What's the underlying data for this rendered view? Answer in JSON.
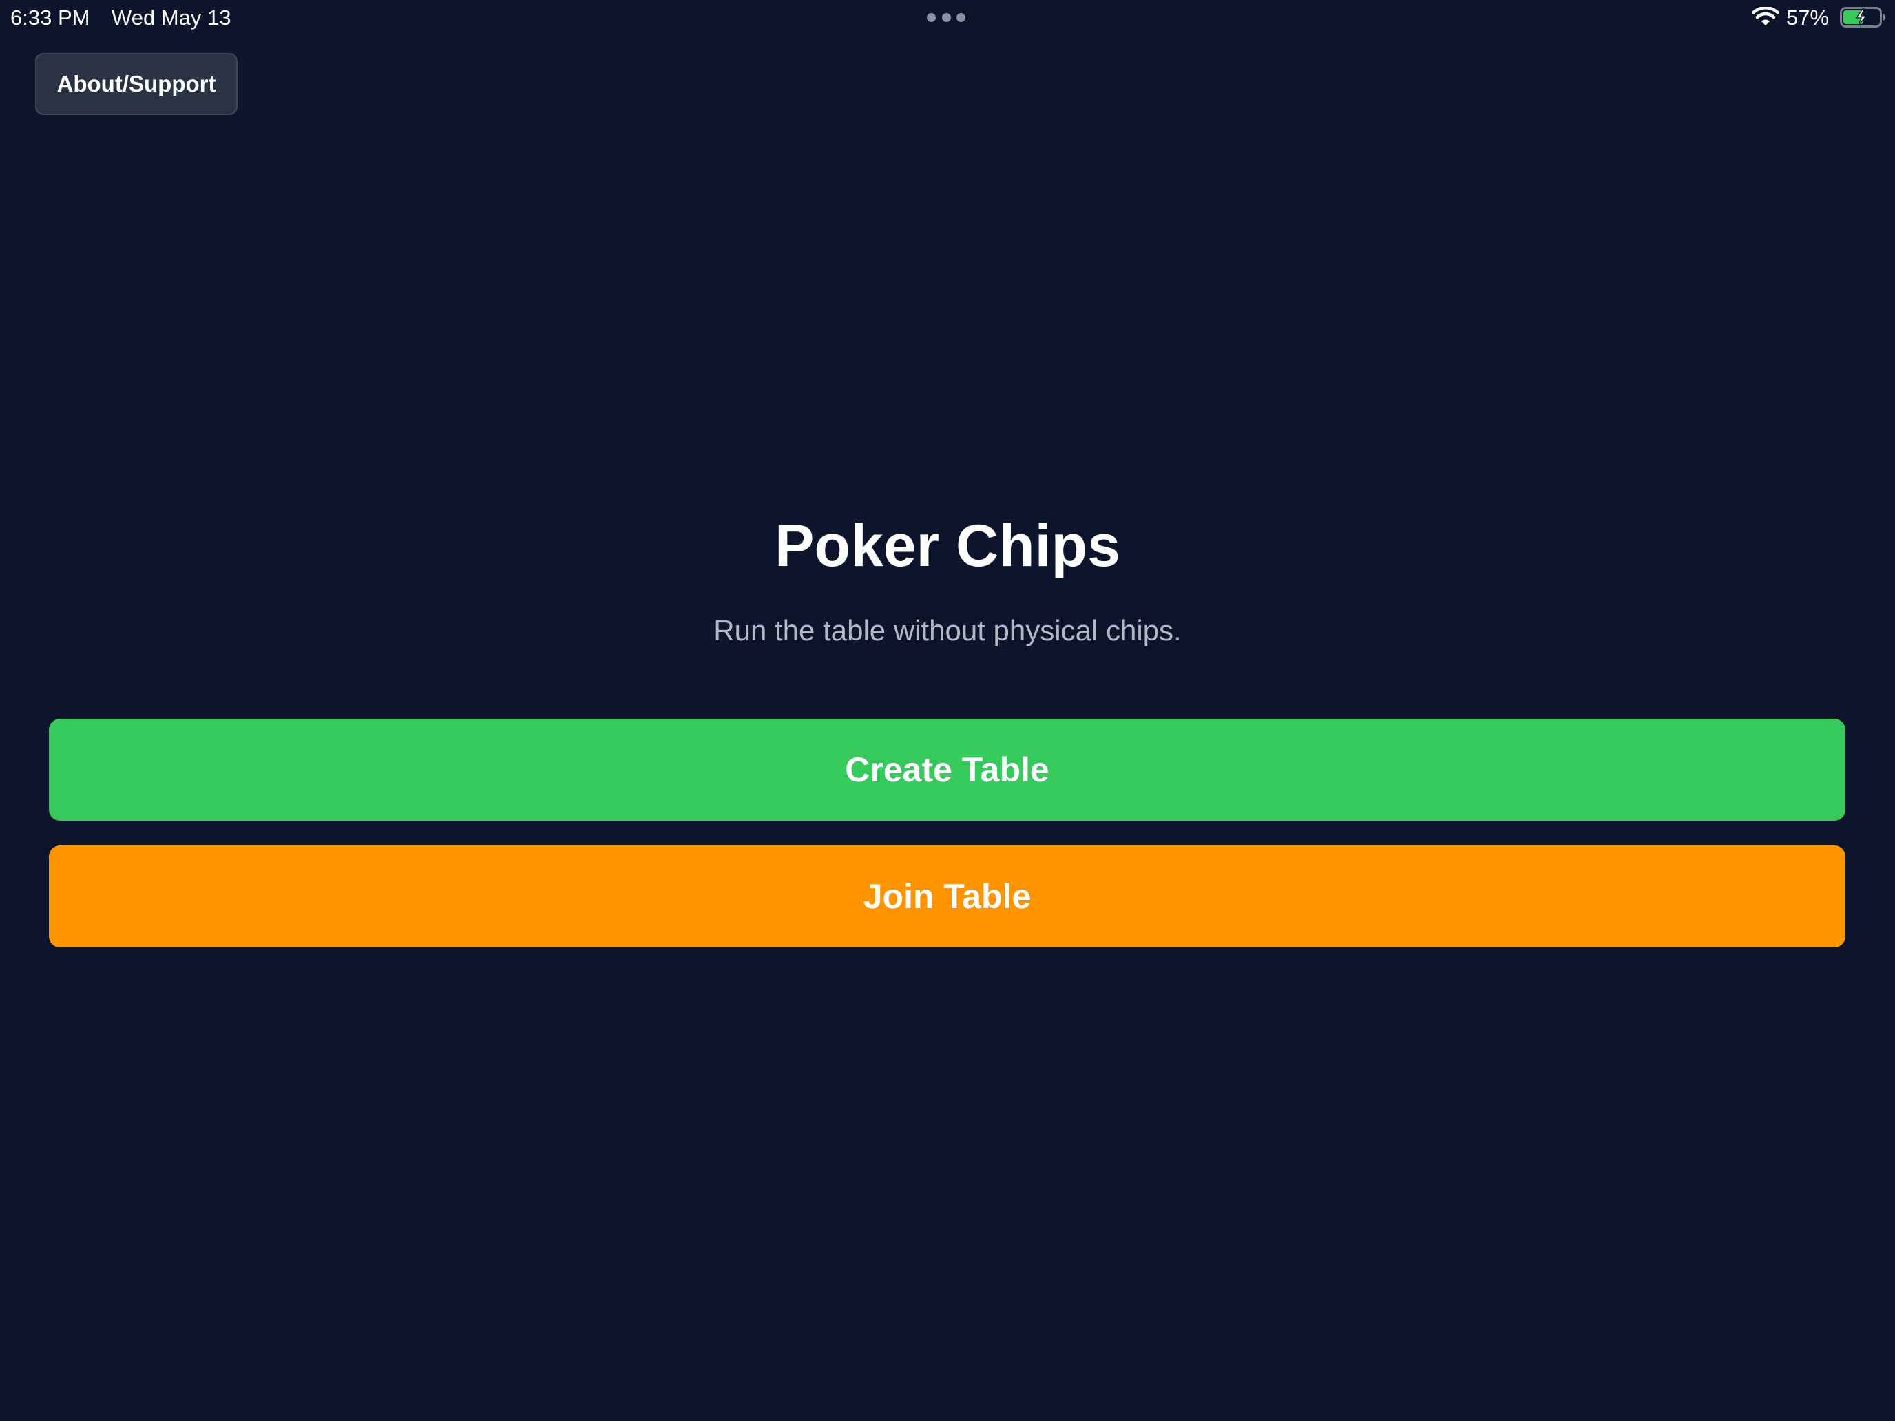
{
  "status_bar": {
    "time": "6:33 PM",
    "date": "Wed May 13",
    "battery_percent": "57%",
    "battery_level": 0.57,
    "charging": true,
    "wifi_icon": "wifi-icon",
    "battery_icon": "battery-charging-icon"
  },
  "header": {
    "about_label": "About/Support"
  },
  "main": {
    "title": "Poker Chips",
    "subtitle": "Run the table without physical chips.",
    "create_label": "Create Table",
    "join_label": "Join Table"
  },
  "colors": {
    "background": "#0d152d",
    "create_button": "#36c95c",
    "join_button": "#fe9400",
    "about_button": "#2a3344",
    "subtitle_text": "#b3b8c5"
  }
}
